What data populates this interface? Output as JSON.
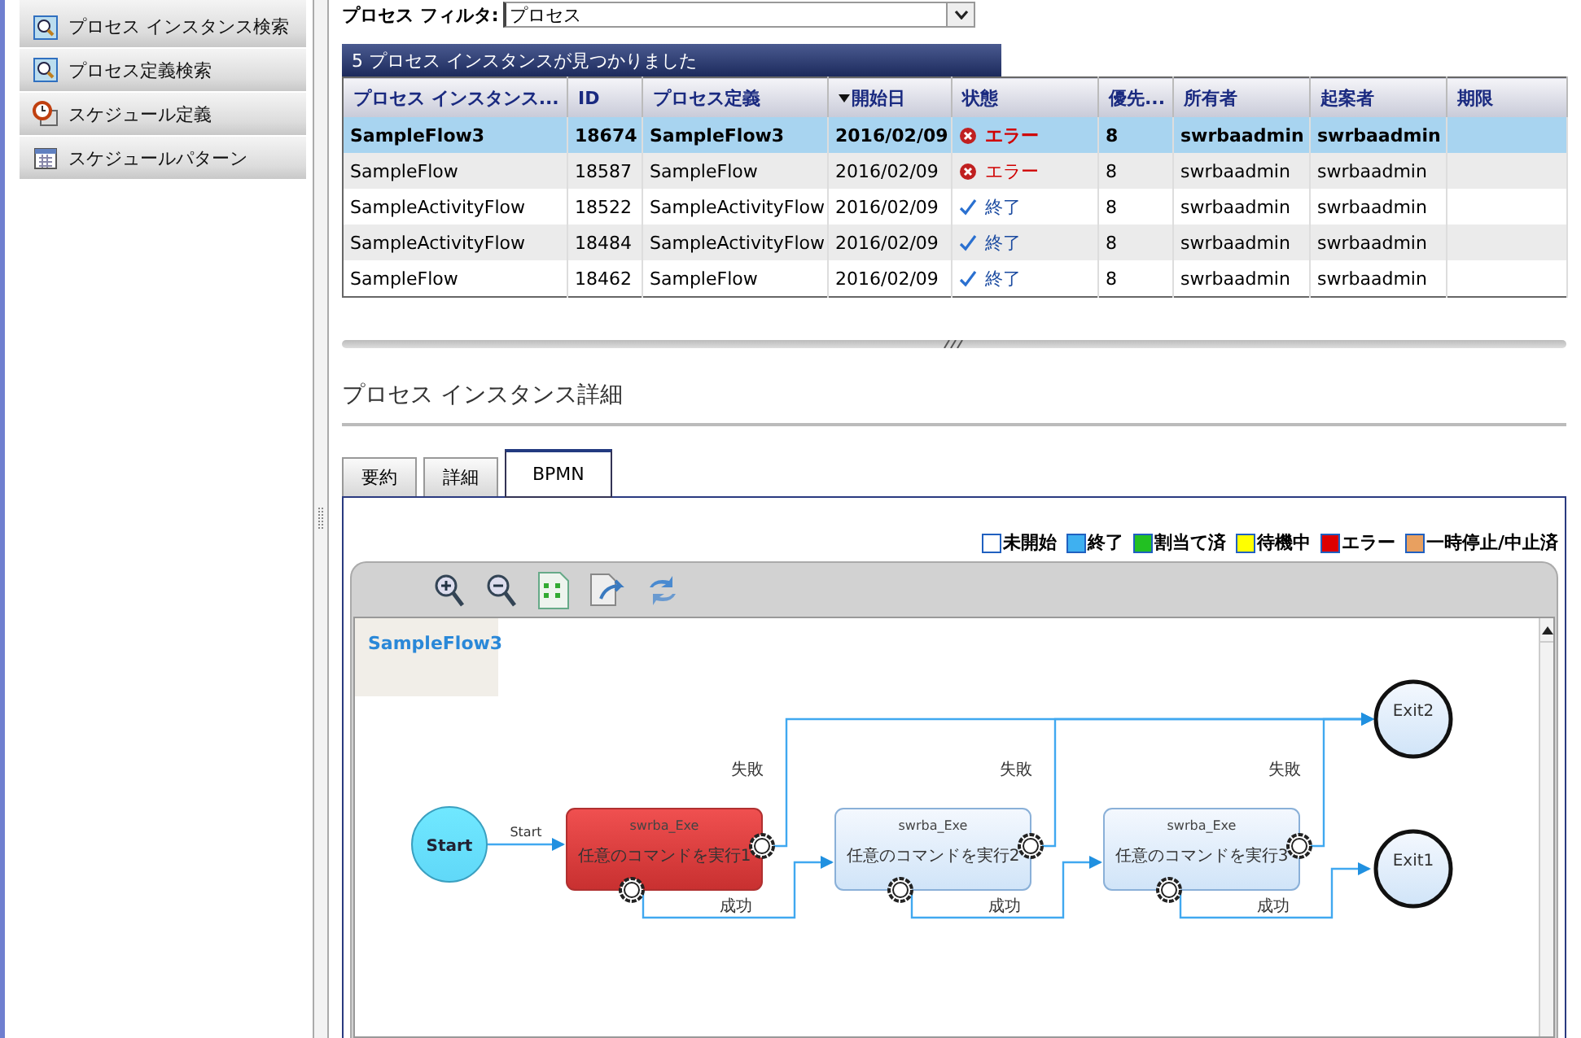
{
  "sidebar": {
    "items": [
      {
        "label": "プロセス インスタンス検索"
      },
      {
        "label": "プロセス定義検索"
      },
      {
        "label": "スケジュール定義"
      },
      {
        "label": "スケジュールパターン"
      }
    ]
  },
  "filter": {
    "label": "プロセス フィルタ:",
    "value": "プロセス"
  },
  "results": {
    "title": "5 プロセス インスタンスが見つかりました",
    "columns": [
      {
        "label": "プロセス インスタンス...",
        "sorted": false
      },
      {
        "label": "ID",
        "sorted": false
      },
      {
        "label": "プロセス定義",
        "sorted": false
      },
      {
        "label": "開始日",
        "sorted": true
      },
      {
        "label": "状態",
        "sorted": false
      },
      {
        "label": "優先...",
        "sorted": false
      },
      {
        "label": "所有者",
        "sorted": false
      },
      {
        "label": "起案者",
        "sorted": false
      },
      {
        "label": "期限",
        "sorted": false
      }
    ],
    "rows": [
      {
        "selected": true,
        "cells": [
          "SampleFlow3",
          "18674",
          "SampleFlow3",
          "2016/02/09"
        ],
        "status": {
          "kind": "error",
          "text": "エラー"
        },
        "rest": [
          "8",
          "swrbaadmin",
          "swrbaadmin"
        ]
      },
      {
        "selected": false,
        "cells": [
          "SampleFlow",
          "18587",
          "SampleFlow",
          "2016/02/09"
        ],
        "status": {
          "kind": "error",
          "text": "エラー"
        },
        "rest": [
          "8",
          "swrbaadmin",
          "swrbaadmin"
        ]
      },
      {
        "selected": false,
        "cells": [
          "SampleActivityFlow",
          "18522",
          "SampleActivityFlow",
          "2016/02/09"
        ],
        "status": {
          "kind": "done",
          "text": "終了"
        },
        "rest": [
          "8",
          "swrbaadmin",
          "swrbaadmin"
        ]
      },
      {
        "selected": false,
        "cells": [
          "SampleActivityFlow",
          "18484",
          "SampleActivityFlow",
          "2016/02/09"
        ],
        "status": {
          "kind": "done",
          "text": "終了"
        },
        "rest": [
          "8",
          "swrbaadmin",
          "swrbaadmin"
        ]
      },
      {
        "selected": false,
        "cells": [
          "SampleFlow",
          "18462",
          "SampleFlow",
          "2016/02/09"
        ],
        "status": {
          "kind": "done",
          "text": "終了"
        },
        "rest": [
          "8",
          "swrbaadmin",
          "swrbaadmin"
        ]
      }
    ]
  },
  "detail": {
    "heading": "プロセス インスタンス詳細",
    "tabs": [
      {
        "label": "要約",
        "selected": false
      },
      {
        "label": "詳細",
        "selected": false
      },
      {
        "label": "BPMN",
        "selected": true
      }
    ],
    "legend": [
      {
        "label": "未開始",
        "color": "#ffffff"
      },
      {
        "label": "終了",
        "color": "#3fb0f0"
      },
      {
        "label": "割当て済",
        "color": "#22c022"
      },
      {
        "label": "待機中",
        "color": "#ffff00"
      },
      {
        "label": "エラー",
        "color": "#dd0000"
      },
      {
        "label": "一時停止/中止済",
        "color": "#e8a060"
      }
    ],
    "diagram": {
      "title": "SampleFlow3",
      "nodes": [
        {
          "kind": "start",
          "label": "Start"
        },
        {
          "kind": "task",
          "type": "swrba_Exe",
          "label": "任意のコマンドを実行1",
          "error": true
        },
        {
          "kind": "task",
          "type": "swrba_Exe",
          "label": "任意のコマンドを実行2",
          "error": false
        },
        {
          "kind": "task",
          "type": "swrba_Exe",
          "label": "任意のコマンドを実行3",
          "error": false
        },
        {
          "kind": "end",
          "label": "Exit2"
        },
        {
          "kind": "end",
          "label": "Exit1"
        }
      ],
      "edges": [
        {
          "kind": "start",
          "label": "Start"
        },
        {
          "kind": "fail",
          "label": "失敗"
        },
        {
          "kind": "success",
          "label": "成功"
        },
        {
          "kind": "fail",
          "label": "失敗"
        },
        {
          "kind": "success",
          "label": "成功"
        },
        {
          "kind": "fail",
          "label": "失敗"
        },
        {
          "kind": "success",
          "label": "成功"
        }
      ]
    }
  }
}
